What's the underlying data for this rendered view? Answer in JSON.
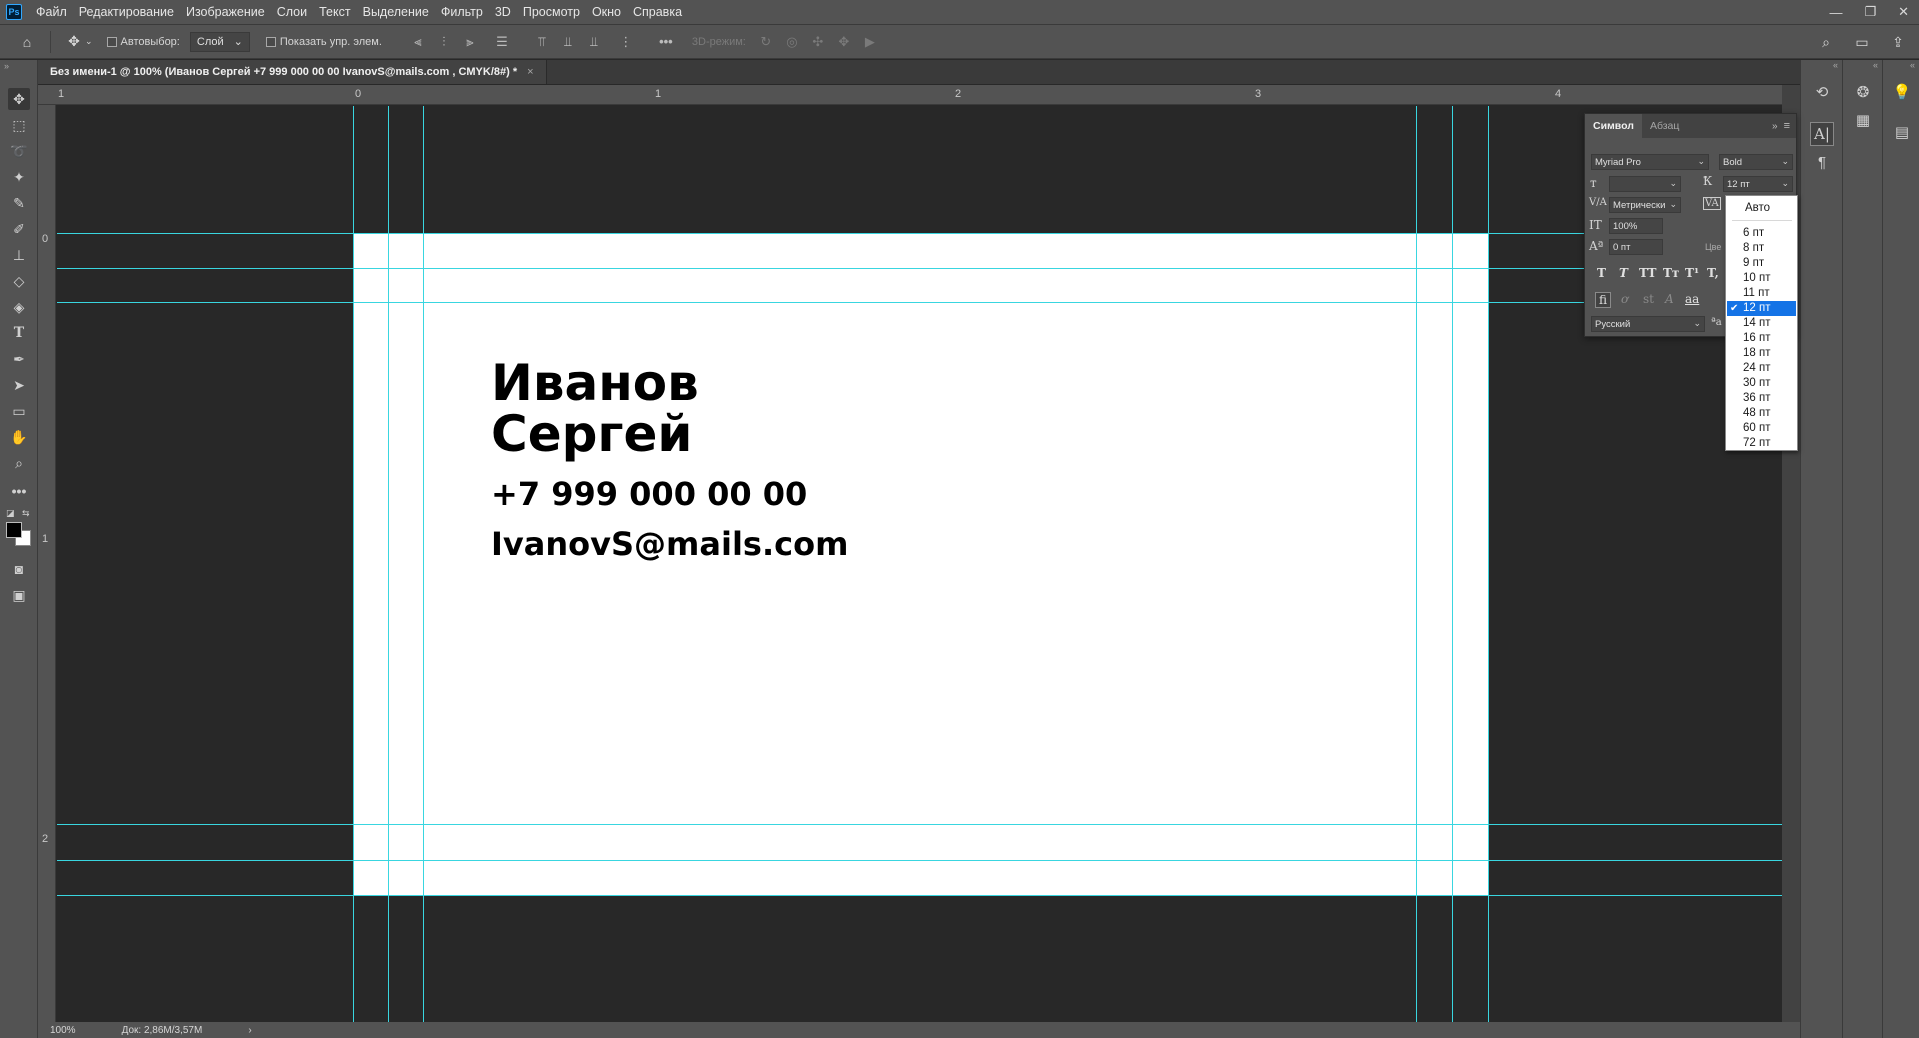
{
  "menubar": {
    "logo": "Ps",
    "items": [
      "Файл",
      "Редактирование",
      "Изображение",
      "Слои",
      "Текст",
      "Выделение",
      "Фильтр",
      "3D",
      "Просмотр",
      "Окно",
      "Справка"
    ]
  },
  "options": {
    "autoselect_label": "Автовыбор:",
    "autoselect_value": "Слой",
    "show_transform_label": "Показать упр. элем.",
    "mode3d_label": "3D-режим:"
  },
  "document": {
    "tab_title": "Без имени-1 @ 100% (Иванов Сергей +7 999 000 00 00  IvanovS@mails.com , CMYK/8#) *",
    "tab_close": "×"
  },
  "ruler": {
    "h_labels": [
      "1",
      "0",
      "1",
      "2",
      "3",
      "4"
    ],
    "v_labels": [
      "0",
      "1",
      "2"
    ]
  },
  "card": {
    "line1": "Иванов",
    "line2": "Сергей",
    "phone": "+7 999 000 00 00",
    "email": "IvanovS@mails.com"
  },
  "status": {
    "zoom": "100%",
    "doc_info": "Док: 2,86M/3,57M",
    "arrow": "›"
  },
  "char_panel": {
    "tab_character": "Символ",
    "tab_paragraph": "Абзац",
    "font_family": "Myriad Pro",
    "font_style": "Bold",
    "font_size": "12 пт",
    "leading": "",
    "kerning": "Метрически",
    "vertical_scale": "100%",
    "baseline_shift": "0 пт",
    "color_label": "Цве",
    "language": "Русский"
  },
  "size_dropdown": {
    "options": [
      "Авто",
      "6 пт",
      "8 пт",
      "9 пт",
      "10 пт",
      "11 пт",
      "12 пт",
      "14 пт",
      "16 пт",
      "18 пт",
      "24 пт",
      "30 пт",
      "36 пт",
      "48 пт",
      "60 пт",
      "72 пт"
    ],
    "selected": "12 пт"
  },
  "colors": {
    "ui_bg": "#535353",
    "canvas_bg": "#282828",
    "guide": "#39d6e0",
    "selection": "#1473e6"
  }
}
